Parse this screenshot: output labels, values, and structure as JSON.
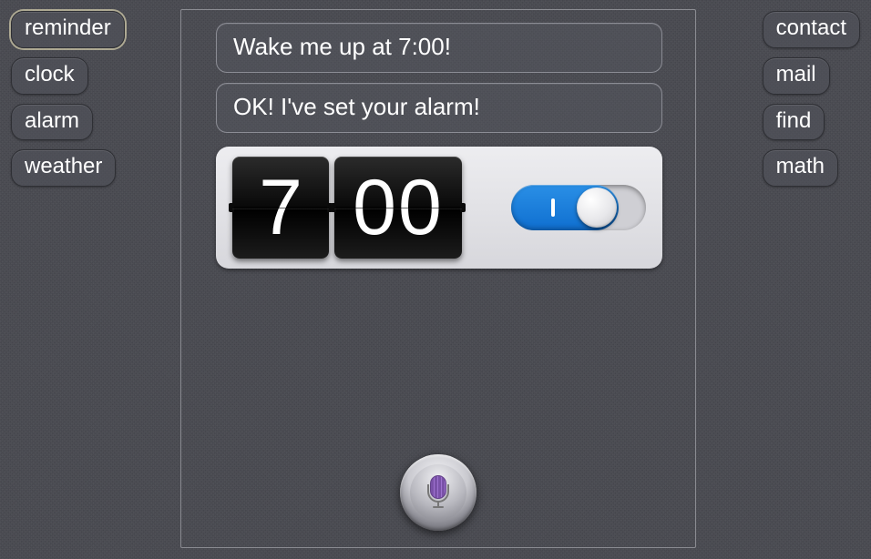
{
  "left_buttons": [
    {
      "label": "reminder",
      "active": true
    },
    {
      "label": "clock",
      "active": false
    },
    {
      "label": "alarm",
      "active": false
    },
    {
      "label": "weather",
      "active": false
    }
  ],
  "right_buttons": [
    {
      "label": "contact"
    },
    {
      "label": "mail"
    },
    {
      "label": "find"
    },
    {
      "label": "math"
    }
  ],
  "conversation": {
    "user_request": "Wake me up at 7:00!",
    "assistant_reply": "OK! I've set your alarm!"
  },
  "alarm": {
    "hour": "7",
    "minute": "00",
    "enabled": true
  }
}
